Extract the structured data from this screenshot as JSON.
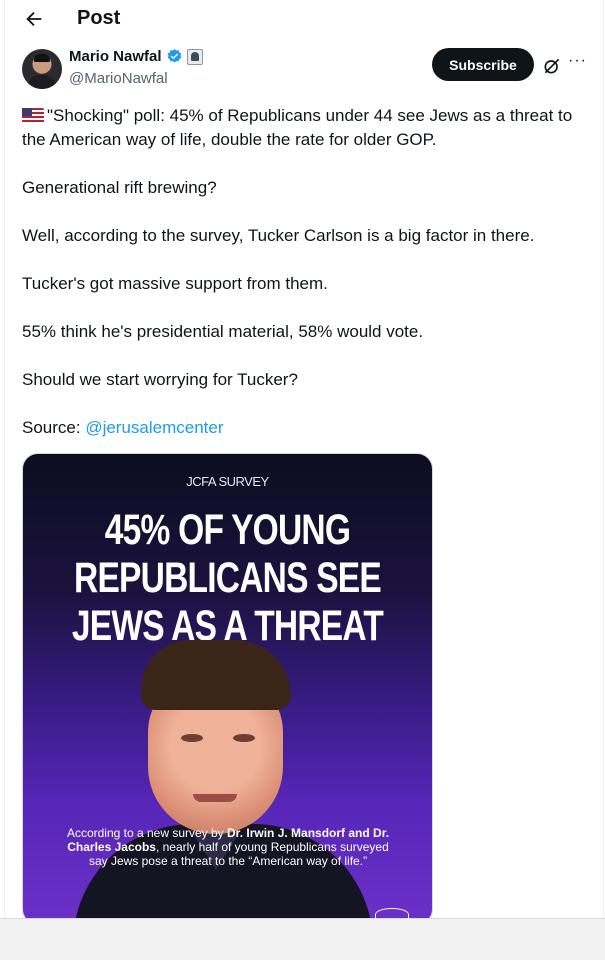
{
  "header": {
    "title": "Post"
  },
  "author": {
    "name": "Mario Nawfal",
    "handle": "@MarioNawfal"
  },
  "actions": {
    "subscribe_label": "Subscribe",
    "more_label": "···"
  },
  "post": {
    "line1": "\"Shocking\" poll: 45% of Republicans under 44 see Jews as a threat to the American way of life, double the rate for older GOP.",
    "line2": "Generational rift brewing?",
    "line3": "Well, according to the survey, Tucker Carlson is a big factor in there.",
    "line4": "Tucker's got massive support from them.",
    "line5": "55% think he's presidential material, 58% would vote.",
    "line6": "Should we start worrying  for Tucker?",
    "source_label": "Source: ",
    "source_link": "@jerusalemcenter"
  },
  "media": {
    "kicker": "JCFA SURVEY",
    "headline": [
      "45% OF YOUNG",
      "REPUBLICANS SEE",
      "JEWS AS A THREAT"
    ],
    "caption_pre": "According to a new survey by ",
    "caption_bold": "Dr. Irwin J. Mansdorf and Dr. Charles Jacobs",
    "caption_post": ", nearly half of young Republicans surveyed say Jews pose a threat to the “American way of life.”"
  },
  "colors": {
    "accent": "#1d9bf0",
    "subscribe_bg": "#0f1419",
    "media_purple": "#5726b8"
  },
  "icons": [
    "back-arrow-icon",
    "verified-badge-icon",
    "affiliate-badge-icon",
    "grok-icon",
    "us-flag-icon",
    "more-icon"
  ]
}
